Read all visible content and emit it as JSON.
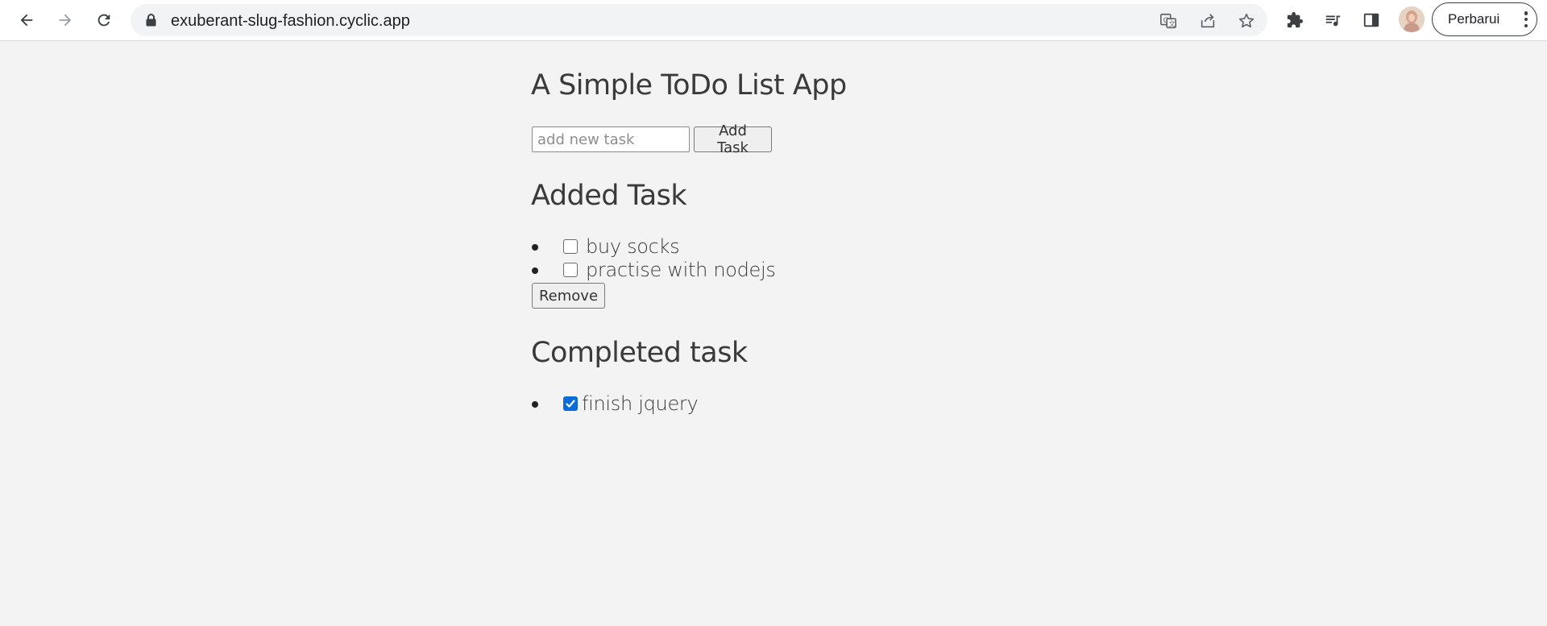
{
  "browser": {
    "url": "exuberant-slug-fashion.cyclic.app",
    "update_button_label": "Perbarui",
    "icons": {
      "back": "arrow-left-icon",
      "forward": "arrow-right-icon",
      "reload": "reload-icon",
      "lock": "lock-icon",
      "translate": "translate-icon",
      "share": "share-icon",
      "bookmark": "star-icon",
      "extensions": "puzzle-icon",
      "media": "playlist-icon",
      "side_panel": "side-panel-icon",
      "menu": "kebab-menu-icon"
    }
  },
  "page": {
    "title": "A Simple ToDo List App",
    "input_placeholder": "add new task",
    "add_button_label": "Add Task",
    "added_section_title": "Added Task",
    "added_tasks": [
      {
        "text": "buy socks",
        "checked": false
      },
      {
        "text": "practise with nodejs",
        "checked": false
      }
    ],
    "remove_button_label": "Remove",
    "completed_section_title": "Completed task",
    "completed_tasks": [
      {
        "text": "finish jquery",
        "checked": true
      }
    ]
  },
  "colors": {
    "page_background": "#f3f3f3",
    "checkbox_checked": "#0b6bd7"
  }
}
